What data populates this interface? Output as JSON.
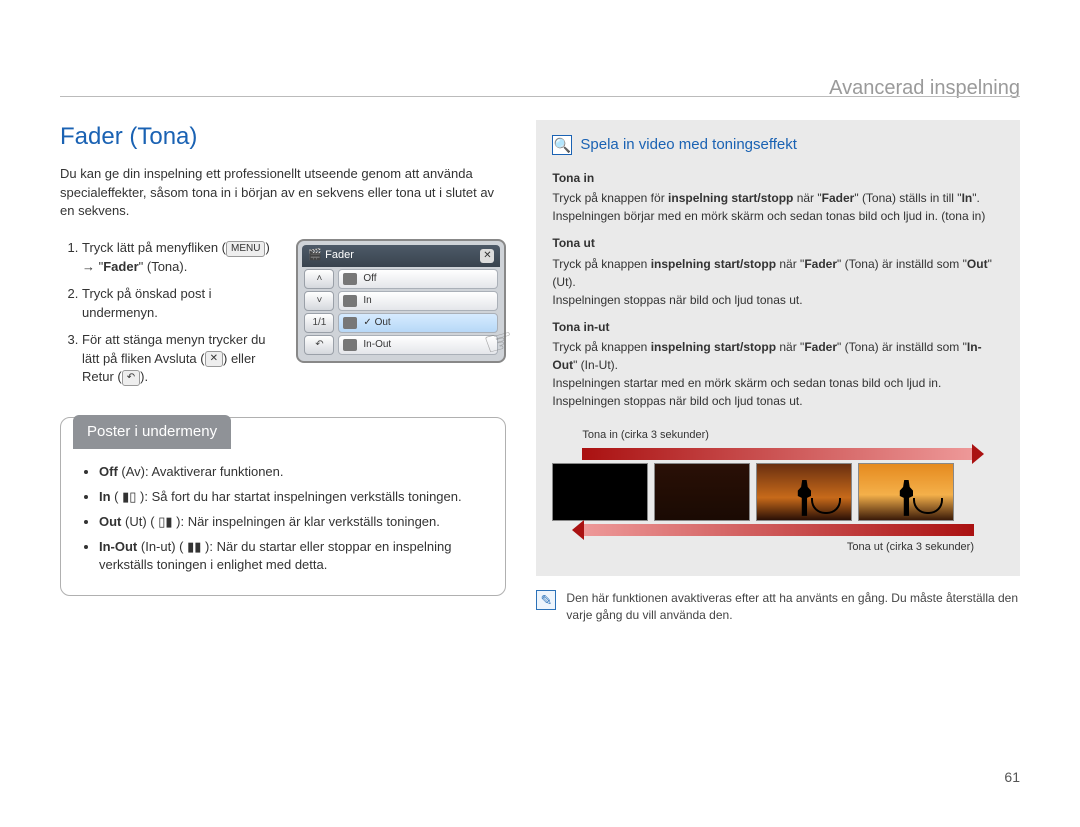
{
  "header": {
    "section_title": "Avancerad inspelning"
  },
  "page_number": "61",
  "left": {
    "heading": "Fader (Tona)",
    "intro": "Du kan ge din inspelning ett professionellt utseende genom att använda specialeffekter, såsom tona in i början av en sekvens eller tona ut i slutet av en sekvens.",
    "steps": {
      "s1_a": "Tryck lätt på menyfliken (",
      "menu_badge": "MENU",
      "s1_b": ") ",
      "s1_arrow": "→",
      "s1_c": " \"",
      "s1_bold": "Fader",
      "s1_d": "\" (Tona).",
      "s2": "Tryck på önskad post i undermenyn.",
      "s3_a": "För att stänga menyn trycker du lätt på fliken Avsluta (",
      "close_badge": "✕",
      "s3_b": ") eller Retur (",
      "return_badge": "↶",
      "s3_c": ")."
    },
    "ui_mock": {
      "title": "Fader",
      "items": [
        "Off",
        "In",
        "Out",
        "In-Out"
      ],
      "side": [
        "˄",
        "˅",
        "1/1",
        "↶"
      ]
    },
    "submenu": {
      "tab": "Poster i undermeny",
      "items": {
        "off_b": "Off",
        "off_t": " (Av): Avaktiverar funktionen.",
        "in_b": "In",
        "in_t": " ( ▮▯ ): Så fort du har startat inspelningen verkställs toningen.",
        "out_b": "Out",
        "out_t1": " (Ut) ( ▯▮ ): ",
        "out_t2": "När inspelningen är klar verkställs toningen.",
        "io_b": "In-Out",
        "io_t1": " (In-ut) ( ▮▮ ): ",
        "io_t2": "När du startar eller stoppar en inspelning verkställs toningen i enlighet med detta."
      }
    }
  },
  "right": {
    "heading": "Spela in video med toningseffekt",
    "tona_in": {
      "h": "Tona in",
      "p1a": "Tryck på knappen för ",
      "p1b": "inspelning start/stopp",
      "p1c": " när \"",
      "p1d": "Fader",
      "p1e": "\" (Tona) ställs in till \"",
      "p1f": "In",
      "p1g": "\". Inspelningen börjar med en mörk skärm och sedan tonas bild och ljud in. (tona in)"
    },
    "tona_ut": {
      "h": "Tona ut",
      "p1a": "Tryck på knappen ",
      "p1b": "inspelning start/stopp",
      "p1c": " när \"",
      "p1d": "Fader",
      "p1e": "\" (Tona) är inställd som \"",
      "p1f": "Out",
      "p1g": "\" (Ut).",
      "p2": "Inspelningen stoppas när bild och ljud tonas ut."
    },
    "tona_io": {
      "h": "Tona in-ut",
      "p1a": "Tryck på knappen ",
      "p1b": "inspelning start/stopp",
      "p1c": " när \"",
      "p1d": "Fader",
      "p1e": "\" (Tona) är inställd som \"",
      "p1f": "In-Out",
      "p1g": "\" (In-Ut).",
      "p2": "Inspelningen startar med en mörk skärm och sedan tonas bild och ljud in. Inspelningen stoppas när bild och ljud tonas ut."
    },
    "diagram": {
      "in_label": "Tona in (cirka 3 sekunder)",
      "out_label": "Tona ut (cirka 3 sekunder)"
    },
    "note": "Den här funktionen avaktiveras efter att ha använts en gång. Du måste återställa den varje gång du vill använda den."
  }
}
